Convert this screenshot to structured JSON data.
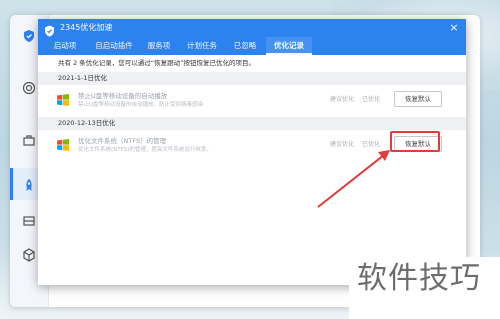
{
  "dialog": {
    "title": "2345优化加速",
    "close_label": "×",
    "tabs": [
      {
        "label": "启动项"
      },
      {
        "label": "自启动插件"
      },
      {
        "label": "服务项"
      },
      {
        "label": "计划任务"
      },
      {
        "label": "已忽略"
      },
      {
        "label": "优化记录"
      }
    ],
    "active_tab": "优化记录",
    "info_text": "共有 2 条优化记录，您可以通过“恢复跟动”按钮恢复已优化的项目。",
    "sections": [
      {
        "date": "2021-1-1日优化",
        "rows": [
          {
            "name": "禁止U盘等移动设备的自动播放",
            "desc": "禁止U盘等移动设备的自动播放，防止受到病毒感染",
            "rec": "建议优化",
            "status": "已优化",
            "button": "恢复默认"
          }
        ]
      },
      {
        "date": "2020-12-13日优化",
        "rows": [
          {
            "name": "优化文件系统（NTFS）的管理",
            "desc": "优化文件系统(NTFS)的管理，提高文件系统运行效率。",
            "rec": "建议优化",
            "status": "已优化",
            "button": "恢复默认"
          }
        ]
      }
    ]
  },
  "colors": {
    "accent": "#2c82ee",
    "highlight": "#e43a3a"
  },
  "watermark": "软件技巧"
}
